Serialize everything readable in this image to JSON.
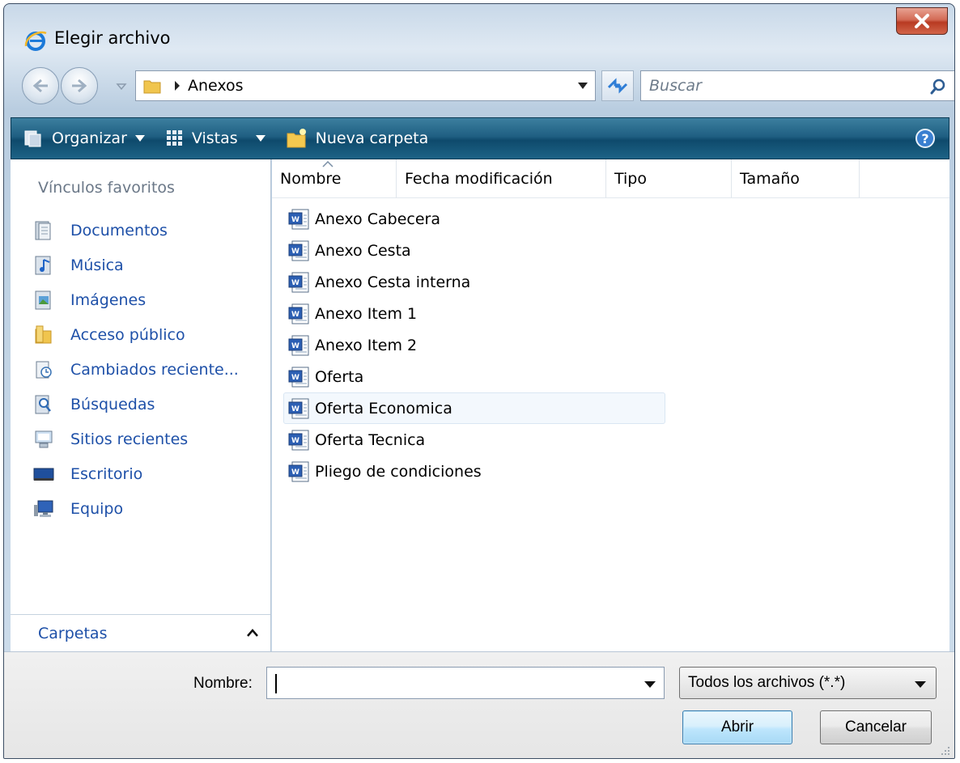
{
  "window": {
    "title": "Elegir archivo",
    "close_symbol": "X"
  },
  "address": {
    "path": [
      "Anexos"
    ],
    "search_placeholder": "Buscar"
  },
  "toolbar": {
    "organize_label": "Organizar",
    "views_label": "Vistas",
    "new_folder_label": "Nueva carpeta"
  },
  "sidebar": {
    "heading": "Vínculos favoritos",
    "items": [
      {
        "label": "Documentos",
        "icon": "documents-icon"
      },
      {
        "label": "Música",
        "icon": "music-icon"
      },
      {
        "label": "Imágenes",
        "icon": "pictures-icon"
      },
      {
        "label": "Acceso público",
        "icon": "public-folder-icon"
      },
      {
        "label": "Cambiados reciente...",
        "icon": "recently-changed-icon"
      },
      {
        "label": "Búsquedas",
        "icon": "searches-icon"
      },
      {
        "label": "Sitios recientes",
        "icon": "recent-places-icon"
      },
      {
        "label": "Escritorio",
        "icon": "desktop-icon"
      },
      {
        "label": "Equipo",
        "icon": "computer-icon"
      }
    ],
    "folders_label": "Carpetas"
  },
  "columns": [
    "Nombre",
    "Fecha modificación",
    "Tipo",
    "Tamaño"
  ],
  "files": [
    "Anexo Cabecera",
    "Anexo Cesta",
    "Anexo Cesta interna",
    "Anexo Item 1",
    "Anexo Item 2",
    "Oferta",
    "Oferta Economica",
    "Oferta Tecnica",
    "Pliego de condiciones"
  ],
  "hovered_file_index": 6,
  "bottom": {
    "name_label": "Nombre:",
    "name_value": "",
    "filter_value": "Todos los archivos (*.*)",
    "open_label": "Abrir",
    "cancel_label": "Cancelar"
  },
  "colors": {
    "link": "#1e50a8",
    "toolbar": "#1f5f82",
    "close": "#c9482e"
  }
}
